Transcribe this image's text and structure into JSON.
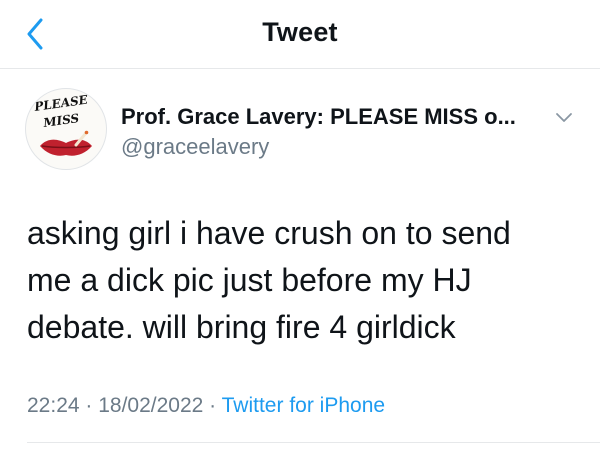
{
  "nav": {
    "title": "Tweet"
  },
  "author": {
    "avatar_text_line1": "PLEASE",
    "avatar_text_line2": "MISS",
    "display_name": "Prof. Grace Lavery: PLEASE MISS o...",
    "handle": "@graceelavery"
  },
  "tweet": {
    "lines": [
      "asking girl i have crush on to send",
      "me a dick pic just before my HJ",
      "debate. will bring fire 4 girldick"
    ],
    "time": "22:24",
    "separator": " · ",
    "date": "18/02/2022",
    "source": "Twitter for iPhone"
  },
  "colors": {
    "accent": "#1d9bf0",
    "secondary_text": "#6b7a87",
    "avatar_lips": "#c0212e"
  },
  "icons": {
    "back": "chevron-left-icon",
    "more": "chevron-down-icon"
  }
}
